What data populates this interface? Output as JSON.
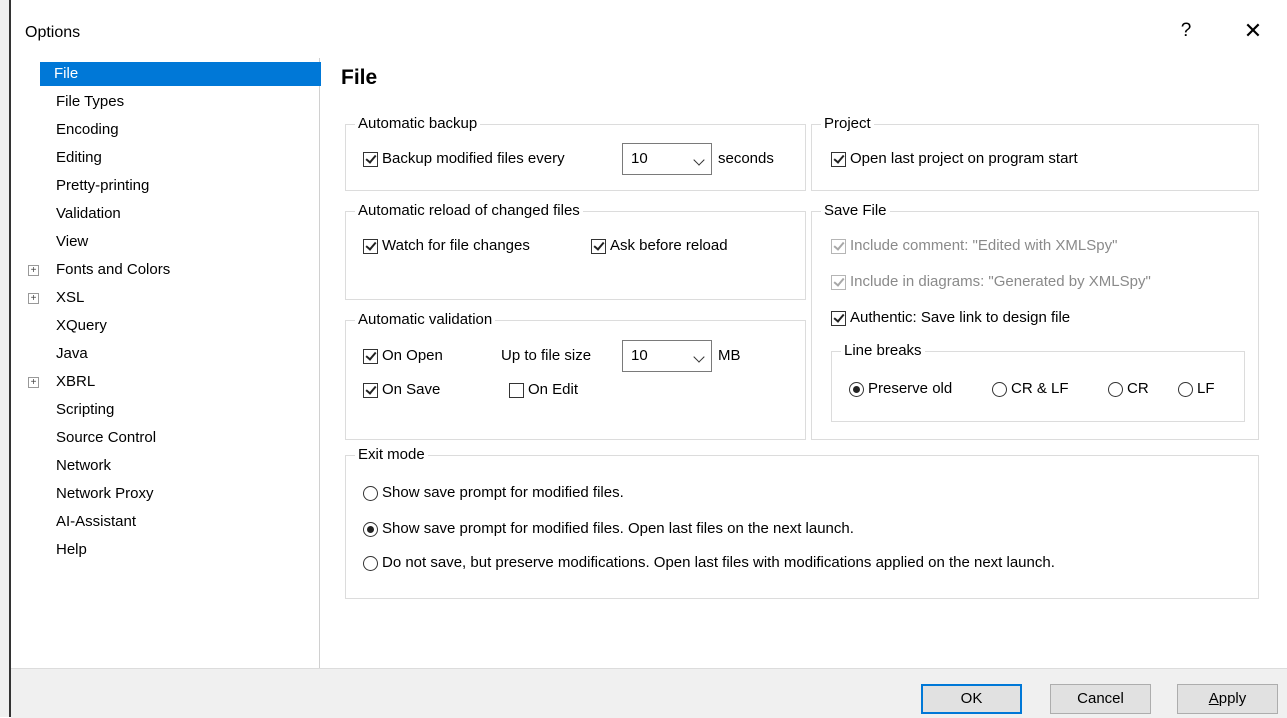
{
  "window": {
    "title": "Options",
    "help_label": "?",
    "close_label": "✕"
  },
  "tree": {
    "items": [
      {
        "label": "File",
        "selected": true,
        "expandable": false
      },
      {
        "label": "File Types",
        "expandable": false
      },
      {
        "label": "Encoding",
        "expandable": false
      },
      {
        "label": "Editing",
        "expandable": false
      },
      {
        "label": "Pretty-printing",
        "expandable": false
      },
      {
        "label": "Validation",
        "expandable": false
      },
      {
        "label": "View",
        "expandable": false
      },
      {
        "label": "Fonts and Colors",
        "expandable": true
      },
      {
        "label": "XSL",
        "expandable": true
      },
      {
        "label": "XQuery",
        "expandable": false
      },
      {
        "label": "Java",
        "expandable": false
      },
      {
        "label": "XBRL",
        "expandable": true
      },
      {
        "label": "Scripting",
        "expandable": false
      },
      {
        "label": "Source Control",
        "expandable": false
      },
      {
        "label": "Network",
        "expandable": false
      },
      {
        "label": "Network Proxy",
        "expandable": false
      },
      {
        "label": "AI-Assistant",
        "expandable": false
      },
      {
        "label": "Help",
        "expandable": false
      }
    ],
    "expander_glyph": "+"
  },
  "page": {
    "title": "File"
  },
  "automatic_backup": {
    "legend": "Automatic backup",
    "backup_label": "Backup modified files every",
    "backup_checked": true,
    "interval_value": "10",
    "unit_label": "seconds"
  },
  "project": {
    "legend": "Project",
    "open_last_label": "Open last project on program start",
    "open_last_checked": true
  },
  "automatic_reload": {
    "legend": "Automatic reload of changed files",
    "watch_label": "Watch for file changes",
    "watch_checked": true,
    "ask_label": "Ask before reload",
    "ask_checked": true
  },
  "save_file": {
    "legend": "Save File",
    "include_comment_label": "Include comment: \"Edited with XMLSpy\"",
    "include_diagrams_label": "Include in diagrams: \"Generated by XMLSpy\"",
    "authentic_label": "Authentic: Save link to design file",
    "line_breaks": {
      "legend": "Line breaks",
      "options": [
        "Preserve old",
        "CR & LF",
        "CR",
        "LF"
      ],
      "selected": "Preserve old"
    }
  },
  "automatic_validation": {
    "legend": "Automatic validation",
    "on_open_label": "On Open",
    "on_save_label": "On Save",
    "on_edit_label": "On Edit",
    "size_label": "Up to file size",
    "size_value": "10",
    "size_unit": "MB"
  },
  "exit_mode": {
    "legend": "Exit mode",
    "options": [
      "Show save prompt for modified files.",
      "Show save prompt for modified files. Open last files on the next launch.",
      "Do not save, but preserve modifications. Open last files with modifications applied on the next launch."
    ],
    "selected_index": 1
  },
  "buttons": {
    "ok": "OK",
    "cancel": "Cancel",
    "apply_underlined": "A",
    "apply_rest": "pply"
  }
}
